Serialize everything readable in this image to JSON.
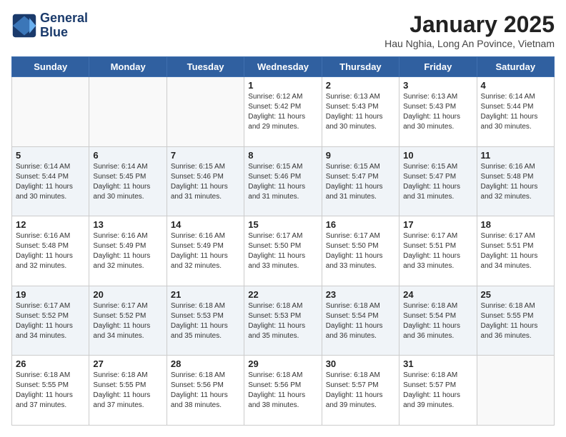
{
  "header": {
    "logo_line1": "General",
    "logo_line2": "Blue",
    "month_title": "January 2025",
    "subtitle": "Hau Nghia, Long An Povince, Vietnam"
  },
  "days_of_week": [
    "Sunday",
    "Monday",
    "Tuesday",
    "Wednesday",
    "Thursday",
    "Friday",
    "Saturday"
  ],
  "weeks": [
    [
      {
        "day": "",
        "info": ""
      },
      {
        "day": "",
        "info": ""
      },
      {
        "day": "",
        "info": ""
      },
      {
        "day": "1",
        "info": "Sunrise: 6:12 AM\nSunset: 5:42 PM\nDaylight: 11 hours and 29 minutes."
      },
      {
        "day": "2",
        "info": "Sunrise: 6:13 AM\nSunset: 5:43 PM\nDaylight: 11 hours and 30 minutes."
      },
      {
        "day": "3",
        "info": "Sunrise: 6:13 AM\nSunset: 5:43 PM\nDaylight: 11 hours and 30 minutes."
      },
      {
        "day": "4",
        "info": "Sunrise: 6:14 AM\nSunset: 5:44 PM\nDaylight: 11 hours and 30 minutes."
      }
    ],
    [
      {
        "day": "5",
        "info": "Sunrise: 6:14 AM\nSunset: 5:44 PM\nDaylight: 11 hours and 30 minutes."
      },
      {
        "day": "6",
        "info": "Sunrise: 6:14 AM\nSunset: 5:45 PM\nDaylight: 11 hours and 30 minutes."
      },
      {
        "day": "7",
        "info": "Sunrise: 6:15 AM\nSunset: 5:46 PM\nDaylight: 11 hours and 31 minutes."
      },
      {
        "day": "8",
        "info": "Sunrise: 6:15 AM\nSunset: 5:46 PM\nDaylight: 11 hours and 31 minutes."
      },
      {
        "day": "9",
        "info": "Sunrise: 6:15 AM\nSunset: 5:47 PM\nDaylight: 11 hours and 31 minutes."
      },
      {
        "day": "10",
        "info": "Sunrise: 6:15 AM\nSunset: 5:47 PM\nDaylight: 11 hours and 31 minutes."
      },
      {
        "day": "11",
        "info": "Sunrise: 6:16 AM\nSunset: 5:48 PM\nDaylight: 11 hours and 32 minutes."
      }
    ],
    [
      {
        "day": "12",
        "info": "Sunrise: 6:16 AM\nSunset: 5:48 PM\nDaylight: 11 hours and 32 minutes."
      },
      {
        "day": "13",
        "info": "Sunrise: 6:16 AM\nSunset: 5:49 PM\nDaylight: 11 hours and 32 minutes."
      },
      {
        "day": "14",
        "info": "Sunrise: 6:16 AM\nSunset: 5:49 PM\nDaylight: 11 hours and 32 minutes."
      },
      {
        "day": "15",
        "info": "Sunrise: 6:17 AM\nSunset: 5:50 PM\nDaylight: 11 hours and 33 minutes."
      },
      {
        "day": "16",
        "info": "Sunrise: 6:17 AM\nSunset: 5:50 PM\nDaylight: 11 hours and 33 minutes."
      },
      {
        "day": "17",
        "info": "Sunrise: 6:17 AM\nSunset: 5:51 PM\nDaylight: 11 hours and 33 minutes."
      },
      {
        "day": "18",
        "info": "Sunrise: 6:17 AM\nSunset: 5:51 PM\nDaylight: 11 hours and 34 minutes."
      }
    ],
    [
      {
        "day": "19",
        "info": "Sunrise: 6:17 AM\nSunset: 5:52 PM\nDaylight: 11 hours and 34 minutes."
      },
      {
        "day": "20",
        "info": "Sunrise: 6:17 AM\nSunset: 5:52 PM\nDaylight: 11 hours and 34 minutes."
      },
      {
        "day": "21",
        "info": "Sunrise: 6:18 AM\nSunset: 5:53 PM\nDaylight: 11 hours and 35 minutes."
      },
      {
        "day": "22",
        "info": "Sunrise: 6:18 AM\nSunset: 5:53 PM\nDaylight: 11 hours and 35 minutes."
      },
      {
        "day": "23",
        "info": "Sunrise: 6:18 AM\nSunset: 5:54 PM\nDaylight: 11 hours and 36 minutes."
      },
      {
        "day": "24",
        "info": "Sunrise: 6:18 AM\nSunset: 5:54 PM\nDaylight: 11 hours and 36 minutes."
      },
      {
        "day": "25",
        "info": "Sunrise: 6:18 AM\nSunset: 5:55 PM\nDaylight: 11 hours and 36 minutes."
      }
    ],
    [
      {
        "day": "26",
        "info": "Sunrise: 6:18 AM\nSunset: 5:55 PM\nDaylight: 11 hours and 37 minutes."
      },
      {
        "day": "27",
        "info": "Sunrise: 6:18 AM\nSunset: 5:55 PM\nDaylight: 11 hours and 37 minutes."
      },
      {
        "day": "28",
        "info": "Sunrise: 6:18 AM\nSunset: 5:56 PM\nDaylight: 11 hours and 38 minutes."
      },
      {
        "day": "29",
        "info": "Sunrise: 6:18 AM\nSunset: 5:56 PM\nDaylight: 11 hours and 38 minutes."
      },
      {
        "day": "30",
        "info": "Sunrise: 6:18 AM\nSunset: 5:57 PM\nDaylight: 11 hours and 39 minutes."
      },
      {
        "day": "31",
        "info": "Sunrise: 6:18 AM\nSunset: 5:57 PM\nDaylight: 11 hours and 39 minutes."
      },
      {
        "day": "",
        "info": ""
      }
    ]
  ]
}
